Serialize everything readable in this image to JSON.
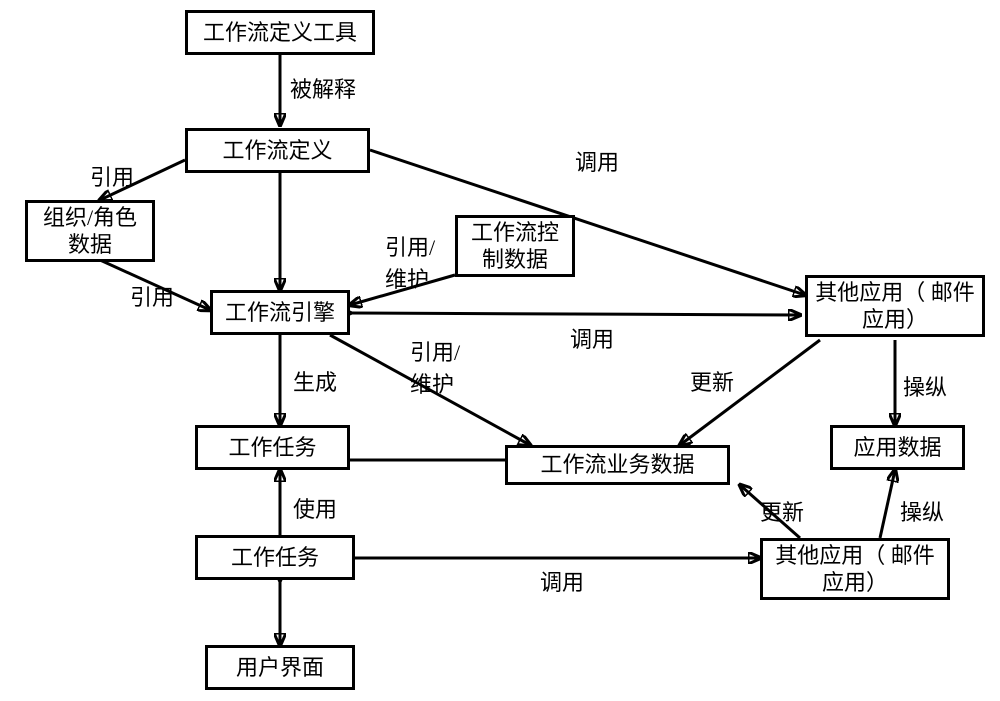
{
  "boxes": {
    "def_tool": "工作流定义工具",
    "definition": "工作流定义",
    "org_role": "组织/角色\n数据",
    "engine": "工作流引擎",
    "ctrl_data": "工作流控\n制数据",
    "other_app1": "其他应用（ 邮件\n应用）",
    "work_task1": "工作任务",
    "biz_data": "工作流业务数据",
    "app_data": "应用数据",
    "work_task2": "工作任务",
    "other_app2": "其他应用（ 邮件\n应用）",
    "user_ui": "用户界面"
  },
  "edges": {
    "interpreted": "被解释",
    "reference": "引用",
    "ref_maint": "引用/\n维护",
    "invoke": "调用",
    "generate": "生成",
    "update": "更新",
    "manipulate": "操纵",
    "use": "使用"
  }
}
